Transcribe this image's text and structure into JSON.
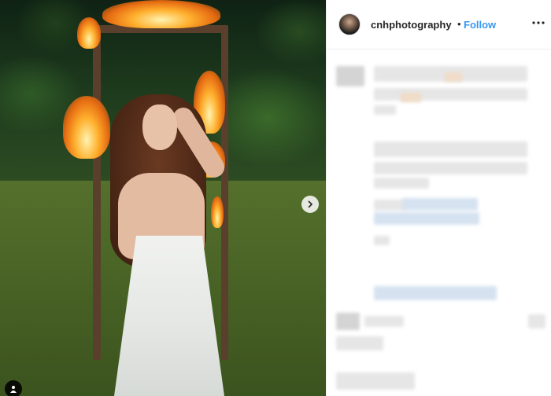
{
  "post": {
    "username": "cnhphotography",
    "separator": "•",
    "follow_label": "Follow",
    "more_icon": "more-horizontal-icon",
    "avatar_icon": "avatar-icon"
  },
  "photo": {
    "next_icon": "chevron-right-icon",
    "tag_icon": "user-tag-icon"
  },
  "colors": {
    "accent": "#3897f0",
    "text": "#262626",
    "border": "#efefef"
  }
}
